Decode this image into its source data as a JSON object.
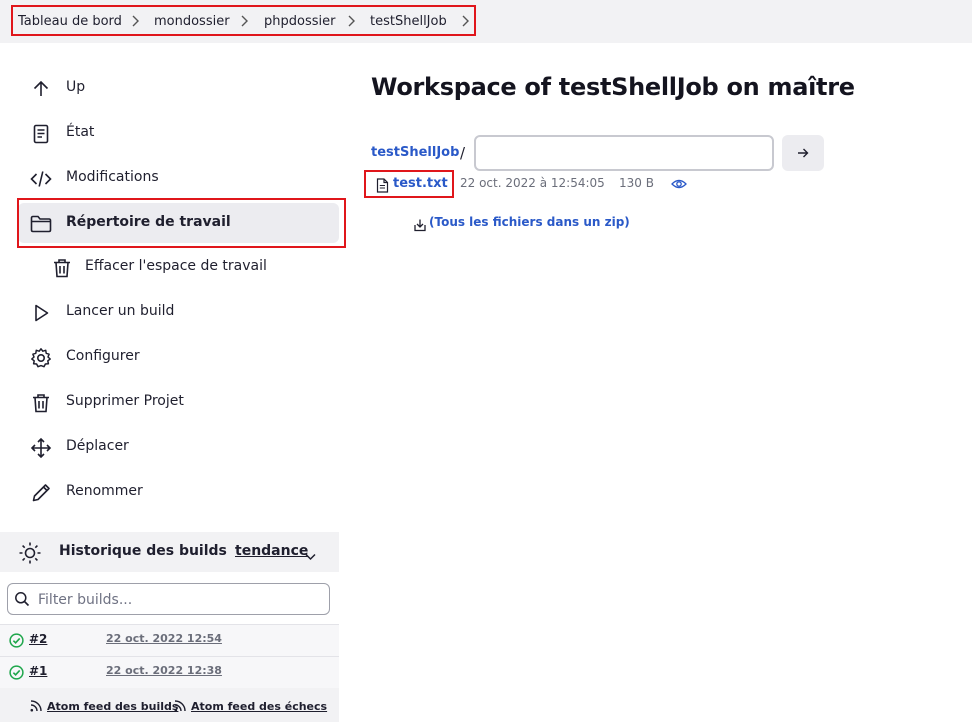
{
  "breadcrumb": [
    "Tableau de bord",
    "mondossier",
    "phpdossier",
    "testShellJob"
  ],
  "sidebar": {
    "items": [
      {
        "label": "Up",
        "icon": "arrow-up-icon"
      },
      {
        "label": "État",
        "icon": "document-icon"
      },
      {
        "label": "Modifications",
        "icon": "code-icon"
      },
      {
        "label": "Répertoire de travail",
        "icon": "folder-icon",
        "active": true
      },
      {
        "label": "Effacer l'espace de travail",
        "icon": "trash-icon"
      },
      {
        "label": "Lancer un build",
        "icon": "play-icon"
      },
      {
        "label": "Configurer",
        "icon": "gear-icon"
      },
      {
        "label": "Supprimer Projet",
        "icon": "trash-icon"
      },
      {
        "label": "Déplacer",
        "icon": "move-icon"
      },
      {
        "label": "Renommer",
        "icon": "pencil-icon"
      }
    ]
  },
  "build_history": {
    "title": "Historique des builds",
    "trend_label": "tendance",
    "filter_placeholder": "Filter builds...",
    "builds": [
      {
        "number": "#2",
        "date": "22 oct. 2022 12:54",
        "status": "success"
      },
      {
        "number": "#1",
        "date": "22 oct. 2022 12:38",
        "status": "success"
      }
    ],
    "feeds": [
      "Atom feed des builds",
      "Atom feed des échecs"
    ]
  },
  "main": {
    "title": "Workspace of testShellJob on maître",
    "root_link": "testShellJob",
    "separator": "/",
    "path_value": "",
    "files": [
      {
        "name": "test.txt",
        "date": "22 oct. 2022 à 12:54:05",
        "size": "130 B"
      }
    ],
    "zip_link": "(Tous les fichiers dans un zip)"
  },
  "colors": {
    "link": "#2a59c8",
    "highlight": "#e0161b",
    "success": "#1ea64b",
    "panel": "#f2f2f4"
  }
}
